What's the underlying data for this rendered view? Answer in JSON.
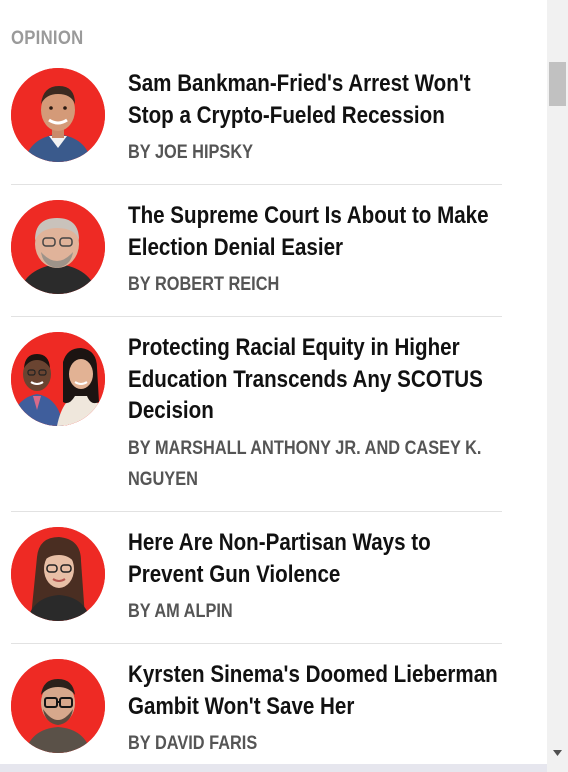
{
  "section": {
    "label": "OPINION"
  },
  "articles": [
    {
      "headline": "Sam Bankman-Fried's Arrest Won't Stop a Crypto-Fueled Recession",
      "byline": "BY JOE HIPSKY",
      "avatar_icon": "author-photo-joe-hipsky"
    },
    {
      "headline": "The Supreme Court Is About to Make Election Denial Easier",
      "byline": "BY ROBERT REICH",
      "avatar_icon": "author-photo-robert-reich"
    },
    {
      "headline": "Protecting Racial Equity in Higher Education Transcends Any SCOTUS Decision",
      "byline": "BY MARSHALL ANTHONY JR. AND CASEY K. NGUYEN",
      "avatar_icon": "author-photo-marshall-anthony-casey-nguyen"
    },
    {
      "headline": "Here Are Non-Partisan Ways to Prevent Gun Violence",
      "byline": "BY AM ALPIN",
      "avatar_icon": "author-photo-am-alpin"
    },
    {
      "headline": "Kyrsten Sinema's Doomed Lieberman Gambit Won't Save Her",
      "byline": "BY DAVID FARIS",
      "avatar_icon": "author-photo-david-faris"
    }
  ],
  "colors": {
    "avatar_background": "#ee2a24",
    "headline": "#111111",
    "byline": "#555555",
    "section_label": "#9a9a9a"
  }
}
